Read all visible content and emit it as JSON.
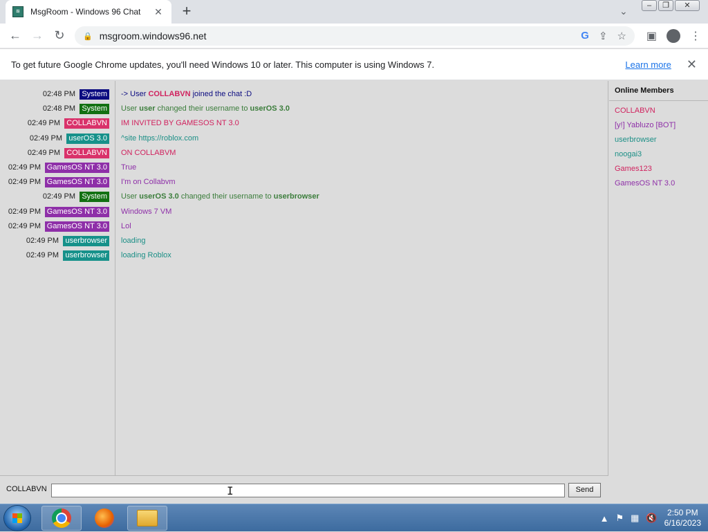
{
  "browser": {
    "tab_title": "MsgRoom - Windows 96 Chat",
    "favicon_glyph": "≋",
    "tab_close_glyph": "✕",
    "new_tab_glyph": "+",
    "url": "msgroom.windows96.net",
    "back_glyph": "←",
    "forward_glyph": "→",
    "reload_glyph": "↻",
    "lock_glyph": "🔒",
    "google_glyph": "G",
    "share_glyph": "⇪",
    "star_glyph": "☆",
    "sidepanel_glyph": "▣",
    "menu_glyph": "⋮",
    "dropdown_glyph": "⌄",
    "win_min_glyph": "–",
    "win_max_glyph": "❐",
    "win_close_glyph": "✕"
  },
  "infobar": {
    "message": "To get future Google Chrome updates, you'll need Windows 10 or later. This computer is using Windows 7.",
    "learn_more": "Learn more",
    "close_glyph": "✕"
  },
  "chat": {
    "messages": [
      {
        "time": "02:48 PM",
        "user": "System",
        "badge_color": "#0b0b80",
        "text_color": "#0b0b80",
        "parts": [
          "-> User ",
          {
            "b": "COLLABVN",
            "color": "#d0225e"
          },
          " joined the chat :D"
        ]
      },
      {
        "time": "02:48 PM",
        "user": "System",
        "badge_color": "#127012",
        "text_color": "#3b7d3b",
        "parts": [
          "User ",
          {
            "b": "user"
          },
          " changed their username to ",
          {
            "b": "userOS 3.0"
          }
        ]
      },
      {
        "time": "02:49 PM",
        "user": "COLLABVN",
        "badge_color": "#d9326a",
        "text_color": "#d0225e",
        "parts": [
          "IM INVITED BY GAMESOS NT 3.0"
        ]
      },
      {
        "time": "02:49 PM",
        "user": "userOS 3.0",
        "badge_color": "#16918a",
        "text_color": "#1c8f86",
        "parts": [
          "^site https://roblox.com"
        ]
      },
      {
        "time": "02:49 PM",
        "user": "COLLABVN",
        "badge_color": "#d9326a",
        "text_color": "#d0225e",
        "parts": [
          "ON COLLABVM"
        ]
      },
      {
        "time": "02:49 PM",
        "user": "GamesOS NT 3.0",
        "badge_color": "#8e2fa8",
        "text_color": "#8e2fa8",
        "parts": [
          "True"
        ]
      },
      {
        "time": "02:49 PM",
        "user": "GamesOS NT 3.0",
        "badge_color": "#8e2fa8",
        "text_color": "#8e2fa8",
        "parts": [
          "I'm on Collabvm"
        ]
      },
      {
        "time": "02:49 PM",
        "user": "System",
        "badge_color": "#127012",
        "text_color": "#3b7d3b",
        "parts": [
          "User ",
          {
            "b": "userOS 3.0"
          },
          " changed their username to ",
          {
            "b": "userbrowser"
          }
        ]
      },
      {
        "time": "02:49 PM",
        "user": "GamesOS NT 3.0",
        "badge_color": "#8e2fa8",
        "text_color": "#8e2fa8",
        "parts": [
          "Windows 7 VM"
        ]
      },
      {
        "time": "02:49 PM",
        "user": "GamesOS NT 3.0",
        "badge_color": "#8e2fa8",
        "text_color": "#8e2fa8",
        "parts": [
          "Lol"
        ]
      },
      {
        "time": "02:49 PM",
        "user": "userbrowser",
        "badge_color": "#16918a",
        "text_color": "#1c8f86",
        "parts": [
          "loading"
        ]
      },
      {
        "time": "02:49 PM",
        "user": "userbrowser",
        "badge_color": "#16918a",
        "text_color": "#1c8f86",
        "parts": [
          "loading Roblox"
        ]
      }
    ],
    "nickname": "COLLABVN",
    "send_label": "Send",
    "input_value": ""
  },
  "members": {
    "title": "Online Members",
    "list": [
      {
        "name": "COLLABVN",
        "color": "#d0225e"
      },
      {
        "name": "[y!] Yabluzo [BOT]",
        "color": "#8e2fa8"
      },
      {
        "name": "userbrowser",
        "color": "#1c8f86"
      },
      {
        "name": "noogai3",
        "color": "#1c8f86"
      },
      {
        "name": "Games123",
        "color": "#d0225e"
      },
      {
        "name": "GamesOS NT 3.0",
        "color": "#8e2fa8"
      }
    ]
  },
  "taskbar": {
    "time": "2:50 PM",
    "date": "6/16/2023",
    "tray_up_glyph": "▲",
    "tray_flag_glyph": "⚑",
    "tray_network_glyph": "▦",
    "tray_volume_glyph": "🔇"
  }
}
